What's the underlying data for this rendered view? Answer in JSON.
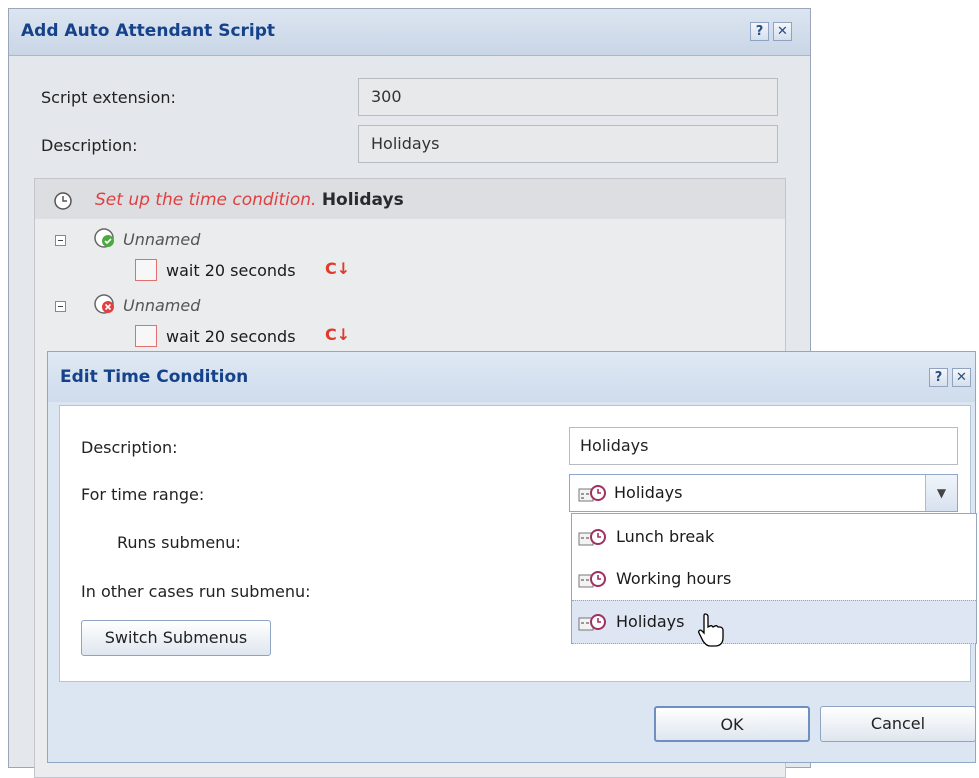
{
  "outer_dialog": {
    "title": "Add Auto Attendant Script",
    "help_label": "?",
    "close_label": "✕",
    "script_extension_label": "Script extension:",
    "script_extension_value": "300",
    "description_label": "Description:",
    "description_value": "Holidays",
    "tree": {
      "header_prefix": "Set up the time condition.",
      "header_name": "Holidays",
      "nodes": [
        {
          "label": "Unnamed",
          "action": "wait 20 seconds"
        },
        {
          "label": "Unnamed",
          "action": "wait 20 seconds"
        }
      ]
    }
  },
  "inner_dialog": {
    "title": "Edit Time Condition",
    "help_label": "?",
    "close_label": "✕",
    "description_label": "Description:",
    "description_value": "Holidays",
    "time_range_label": "For time range:",
    "time_range_selected": "Holidays",
    "runs_submenu_label": "Runs submenu:",
    "other_cases_label": "In other cases run submenu:",
    "switch_button": "Switch Submenus",
    "ok_button": "OK",
    "cancel_button": "Cancel",
    "dropdown_options": [
      "Lunch break",
      "Working hours",
      "Holidays"
    ],
    "dropdown_highlighted": "Holidays"
  },
  "colors": {
    "title_text": "#15428b",
    "warning_text": "#e04040",
    "panel_bg": "#e4e7ec",
    "inner_bg": "#dce6f2"
  }
}
